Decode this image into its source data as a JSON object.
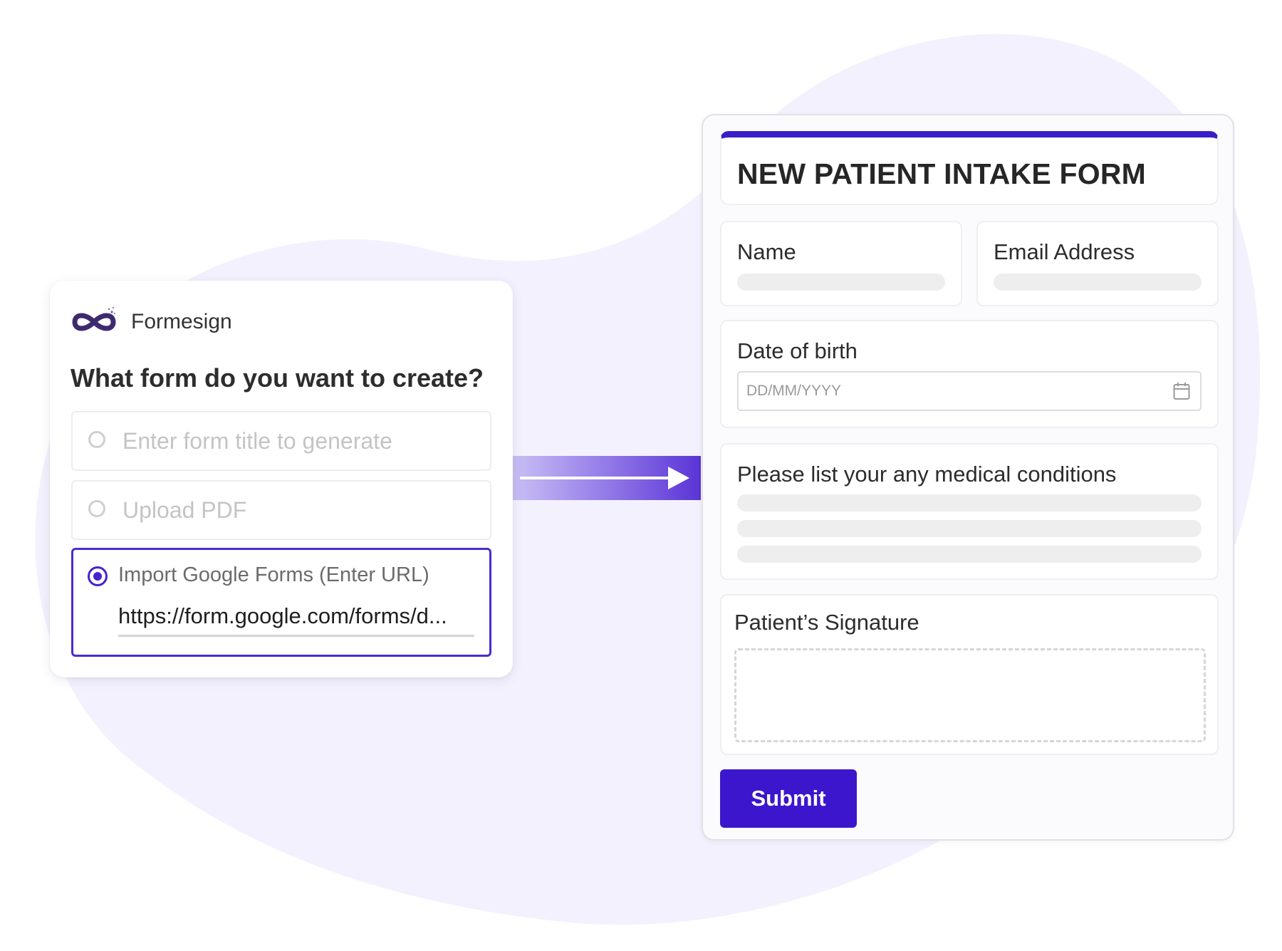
{
  "generator": {
    "brand_name": "Formesign",
    "question": "What form do you want to create?",
    "options": [
      {
        "label": "Enter form title to generate",
        "selected": false
      },
      {
        "label": "Upload PDF",
        "selected": false
      },
      {
        "label": "Import Google Forms (Enter URL)",
        "selected": true,
        "value": "https://form.google.com/forms/d..."
      }
    ]
  },
  "form": {
    "title": "NEW PATIENT INTAKE FORM",
    "fields": {
      "name": "Name",
      "email": "Email Address",
      "dob": "Date of birth",
      "dob_placeholder": "DD/MM/YYYY",
      "medical": "Please list your any medical conditions",
      "signature": "Patient’s Signature"
    },
    "submit_label": "Submit"
  },
  "colors": {
    "accent": "#3c16cc",
    "blob": "#f3f1fd"
  },
  "icons": [
    "formesign-logo-icon",
    "radio-icon",
    "arrow-right-icon",
    "calendar-icon"
  ]
}
